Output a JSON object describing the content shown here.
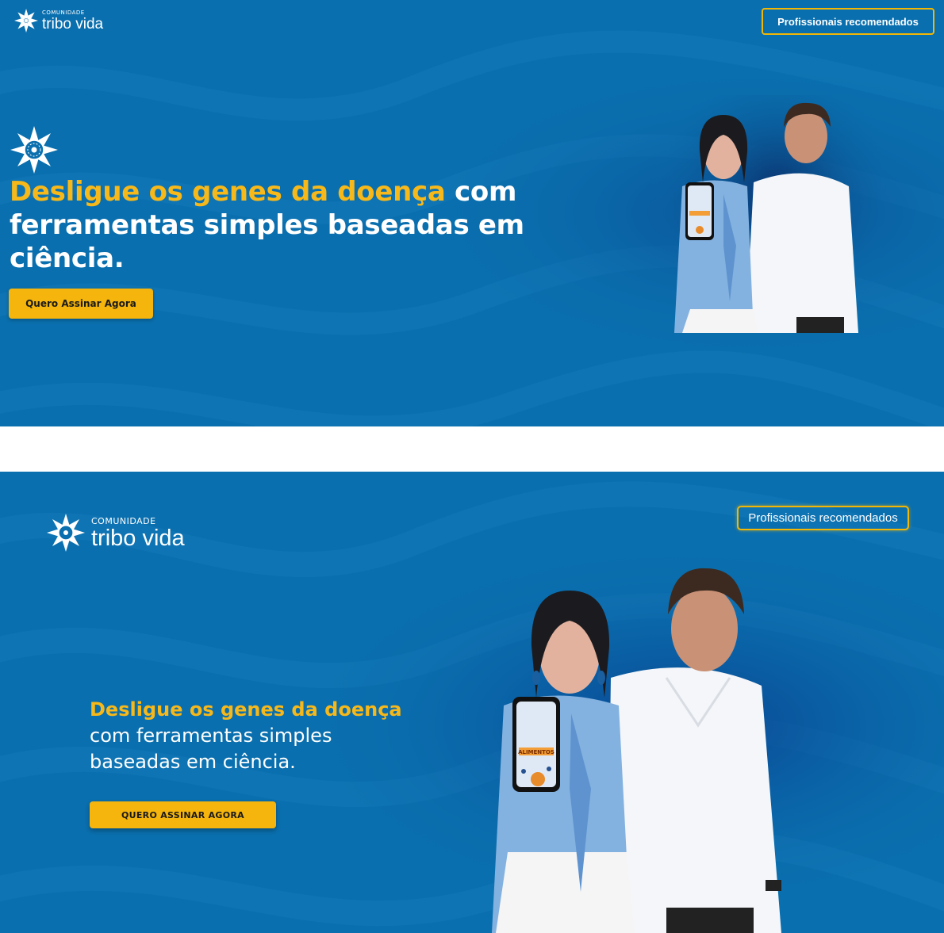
{
  "panels": [
    {
      "logo": {
        "small": "COMUNIDADE",
        "big": "tribo vida",
        "icon": "star-mandala-icon"
      },
      "nav_button": "Profissionais recomendados",
      "headline_highlight": "Desligue os genes da doença",
      "headline_rest": " com ferramentas simples baseadas em ciência.",
      "cta": "Quero Assinar Agora"
    },
    {
      "logo": {
        "small": "COMUNIDADE",
        "big": "tribo vida",
        "icon": "star-mandala-icon"
      },
      "nav_button": "Profissionais recomendados",
      "headline_highlight": "Desligue os genes da doença",
      "headline_rest": " com ferramentas simples baseadas em ciência.",
      "cta": "QUERO ASSINAR AGORA"
    }
  ],
  "phone_screen_text": "ALIMENTOS",
  "colors": {
    "background_blue": "#0a6fae",
    "accent_yellow": "#f5b50c",
    "headline_yellow": "#f7b81a",
    "text_white": "#ffffff"
  }
}
